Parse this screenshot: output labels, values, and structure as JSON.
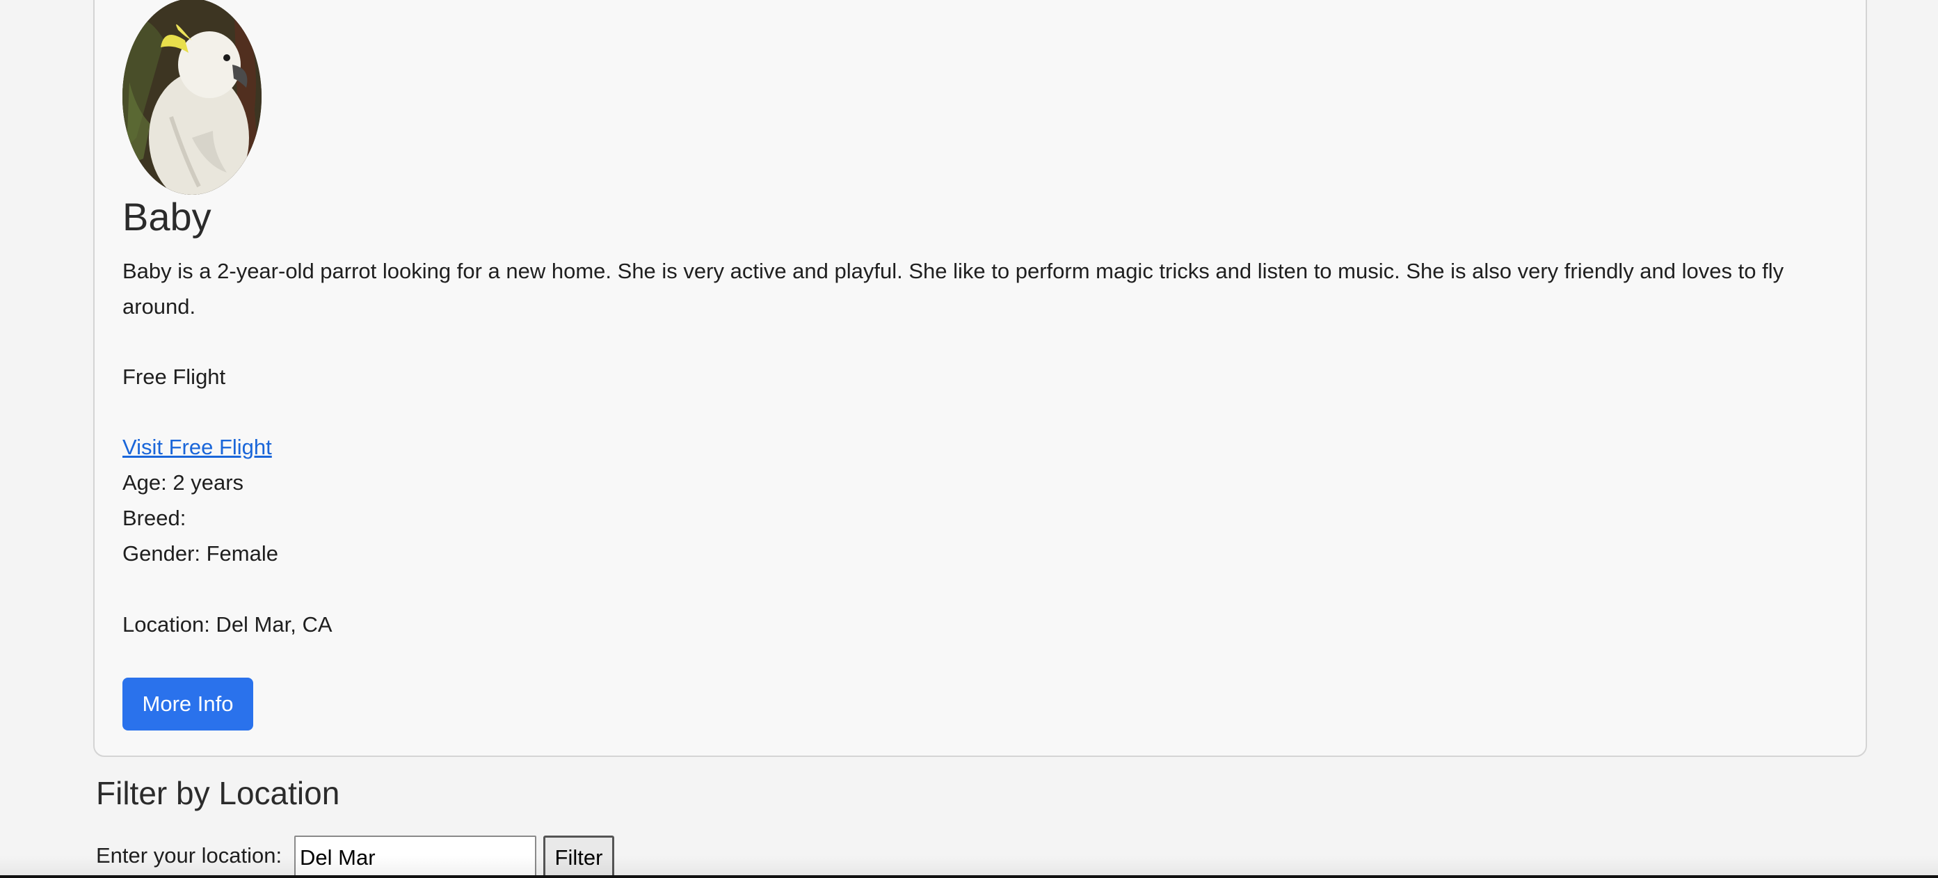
{
  "pet": {
    "name": "Baby",
    "photo_alt": "cockatoo-photo",
    "description": "Baby is a 2-year-old parrot looking for a new home. She is very active and playful. She like to perform magic tricks and listen to music. She is also very friendly and loves to fly around.",
    "organization": "Free Flight",
    "visit_link": "Visit Free Flight",
    "age": "Age: 2 years",
    "breed": "Breed:",
    "gender": "Gender: Female",
    "location": "Location: Del Mar, CA",
    "more_info_label": "More Info"
  },
  "filter": {
    "heading": "Filter by Location",
    "label": "Enter your location:",
    "input_value": "Del Mar",
    "button_label": "Filter"
  },
  "colors": {
    "accent": "#2a72ec",
    "link": "#1a66d9",
    "card_background": "#f8f8f8",
    "page_background": "#f4f4f4"
  }
}
